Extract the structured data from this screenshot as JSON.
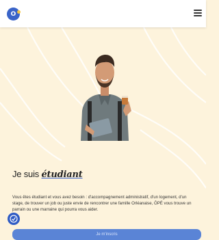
{
  "header": {
    "logo_text": "O",
    "menu_icon": "hamburger-menu-icon"
  },
  "hero": {
    "heading_prefix": "Je suis ",
    "heading_highlight": "étudiant",
    "description": "Vous êtes étudiant et vous avez besoin : d'accompagnement administratif, d'un logement, d'un stage, de trouver un job ou juste envie de rencontrer une famille Orléanaise, ÔPÉ vous trouve un parrain ou une marraine qui pourra vous aider.",
    "cta_label": "Je m'inscris"
  },
  "colors": {
    "background": "#fdf3dc",
    "accent": "#3a64c8",
    "button": "#5a84d6"
  },
  "accessibility_icon": "accessibility-icon"
}
